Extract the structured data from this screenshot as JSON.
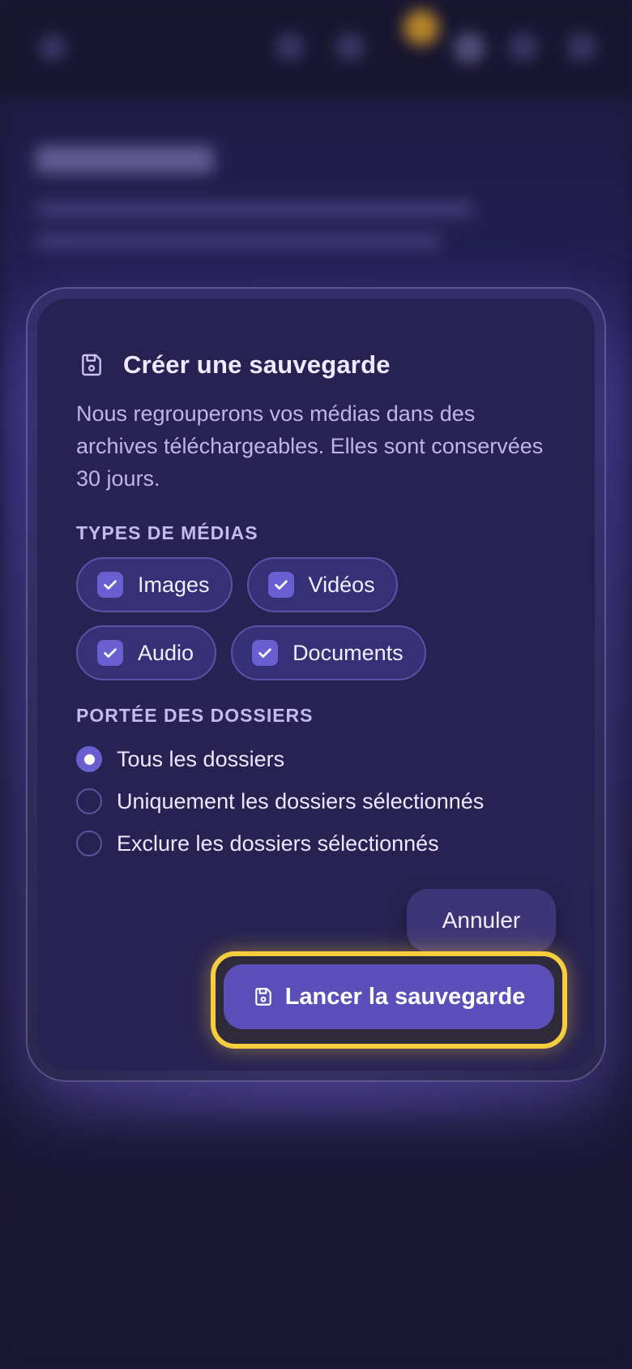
{
  "modal": {
    "title": "Créer une sauvegarde",
    "title_icon": "save-icon",
    "description": "Nous regrouperons vos médias dans des archives téléchargeables. Elles sont conservées 30 jours.",
    "media_types": {
      "label": "TYPES DE MÉDIAS",
      "items": [
        {
          "label": "Images",
          "checked": true
        },
        {
          "label": "Vidéos",
          "checked": true
        },
        {
          "label": "Audio",
          "checked": true
        },
        {
          "label": "Documents",
          "checked": true
        }
      ]
    },
    "folder_scope": {
      "label": "PORTÉE DES DOSSIERS",
      "options": [
        {
          "label": "Tous les dossiers",
          "selected": true
        },
        {
          "label": "Uniquement les dossiers sélectionnés",
          "selected": false
        },
        {
          "label": "Exclure les dossiers sélectionnés",
          "selected": false
        }
      ]
    },
    "cancel_label": "Annuler",
    "start_label": "Lancer la sauvegarde",
    "start_icon": "save-icon"
  },
  "colors": {
    "accent": "#6a5fd0",
    "focus_ring": "#f6cd3f",
    "modal_bg": "#272251"
  }
}
